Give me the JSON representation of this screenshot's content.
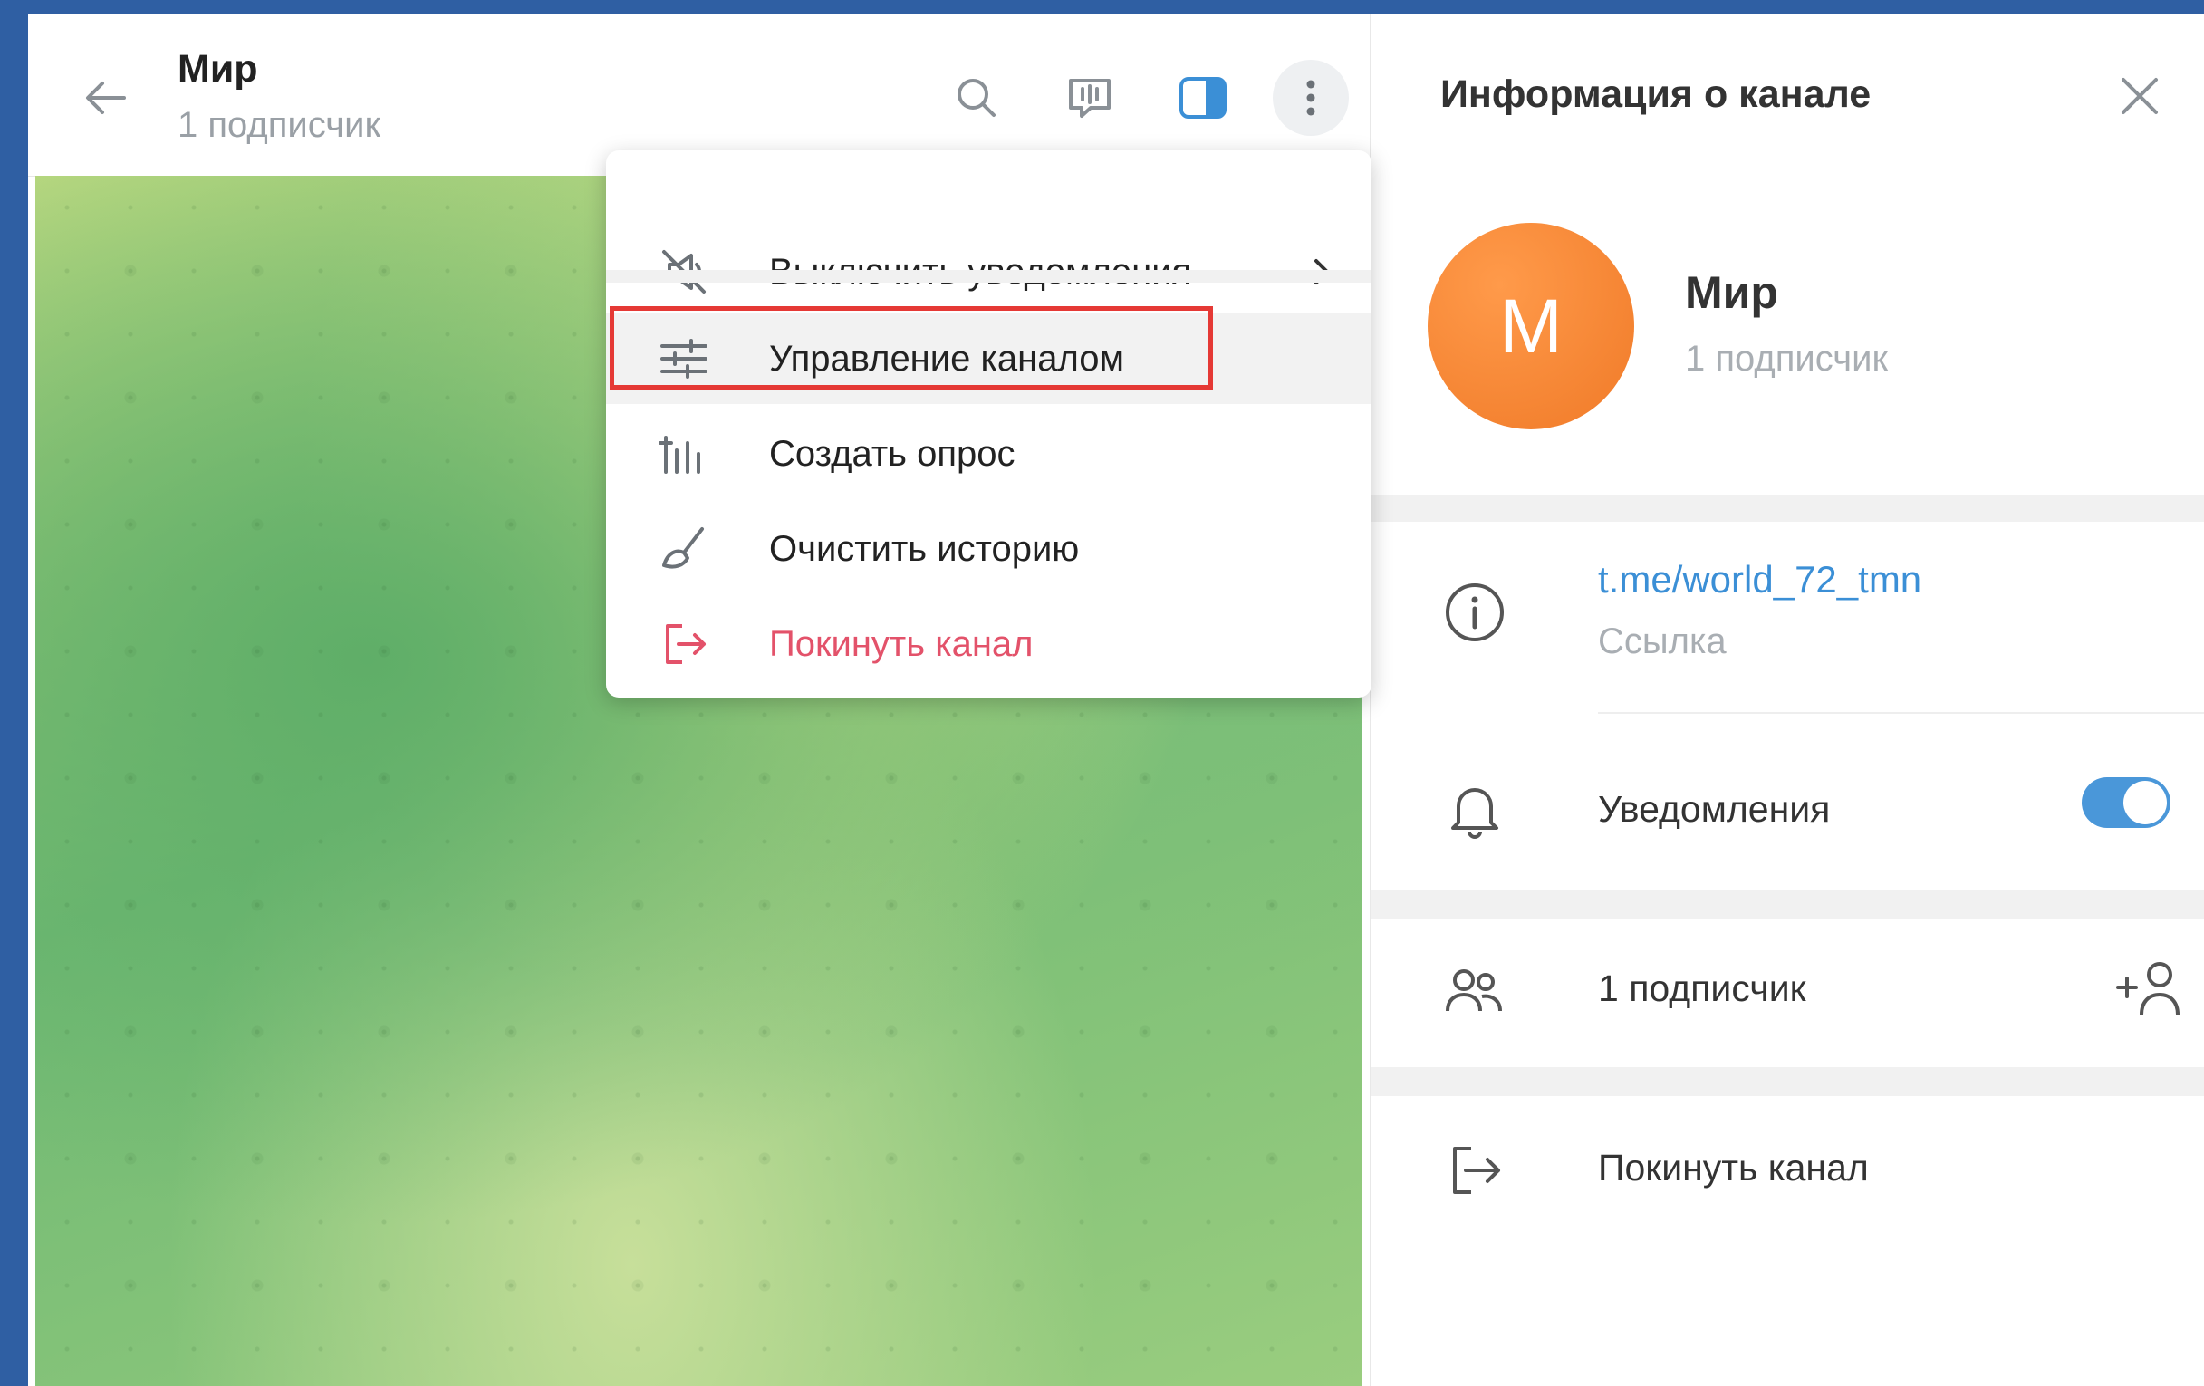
{
  "chat": {
    "title": "Мир",
    "subtitle": "1 подписчик",
    "header_icons": [
      "back-arrow-icon",
      "search-icon",
      "voice-chat-icon",
      "sidebar-toggle-icon",
      "more-vertical-icon"
    ]
  },
  "menu": {
    "items": [
      {
        "label": "Выключить уведомления",
        "icon": "mute-icon",
        "has_submenu": true
      },
      {
        "label": "Управление каналом",
        "icon": "sliders-icon",
        "highlighted": true
      },
      {
        "label": "Создать опрос",
        "icon": "poll-icon"
      },
      {
        "label": "Очистить историю",
        "icon": "broom-icon"
      },
      {
        "label": "Покинуть канал",
        "icon": "leave-icon",
        "danger": true
      }
    ]
  },
  "panel": {
    "title": "Информация о канале",
    "avatar_letter": "M",
    "name": "Мир",
    "subscribers": "1 подписчик",
    "link": "t.me/world_72_tmn",
    "link_caption": "Ссылка",
    "notifications_label": "Уведомления",
    "notifications_on": true,
    "members_label": "1 подписчик",
    "leave_label": "Покинуть канал"
  },
  "colors": {
    "accent": "#4a97d9",
    "avatar": "#f07a28",
    "danger": "#e3526a",
    "highlight_box": "#e53935",
    "outer_background": "#2f5fa3"
  }
}
